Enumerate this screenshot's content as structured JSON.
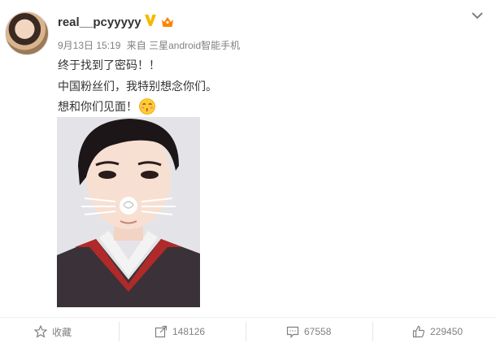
{
  "post": {
    "username": "real__pcyyyyy",
    "date": "9月13日 15:19",
    "from_label": "来自",
    "device": "三星android智能手机",
    "lines": [
      "终于找到了密码！！",
      "中国粉丝们，我特别想念你们。",
      "想和你们见面！"
    ]
  },
  "actions": {
    "favorite_label": "收藏",
    "forward_count": "148126",
    "comment_count": "67558",
    "like_count": "229450"
  },
  "colors": {
    "text": "#333333",
    "meta": "#808080",
    "v_badge": "#f6b900",
    "vip_badge": "#ff8200"
  },
  "icons": [
    "chevron-down-icon",
    "verified-v-icon",
    "vip-crown-icon",
    "kiss-emoji-icon",
    "star-icon",
    "forward-icon",
    "comment-icon",
    "like-icon"
  ]
}
